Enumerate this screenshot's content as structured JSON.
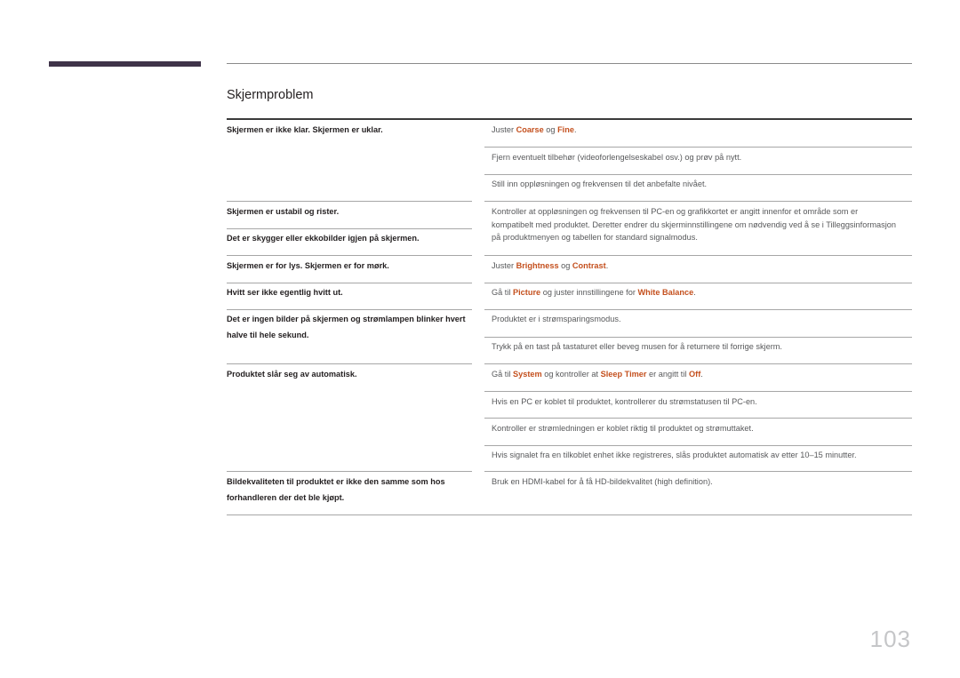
{
  "section": {
    "title": "Skjermproblem"
  },
  "page_number": "103",
  "colors": {
    "accent": "#c4501e",
    "top_bar": "#3f3349"
  },
  "rows": [
    {
      "problem": "Skjermen er ikke klar. Skjermen er uklar.",
      "solutions": [
        [
          {
            "t": "Juster "
          },
          {
            "t": "Coarse",
            "hl": true
          },
          {
            "t": " og "
          },
          {
            "t": "Fine",
            "hl": true
          },
          {
            "t": "."
          }
        ],
        [
          {
            "t": "Fjern eventuelt tilbehør (videoforlengelseskabel osv.) og prøv på nytt."
          }
        ],
        [
          {
            "t": "Still inn oppløsningen og frekvensen til det anbefalte nivået."
          }
        ]
      ]
    },
    {
      "problem": "Skjermen er ustabil og rister.",
      "solutions": [
        [
          {
            "t": "Kontroller at oppløsningen og frekvensen til PC-en og grafikkortet er angitt innenfor et område som er kompatibelt med produktet. Deretter endrer du skjerminnstillingene om nødvendig ved å se i Tilleggsinformasjon på produktmenyen og tabellen for standard signalmodus."
          }
        ]
      ]
    },
    {
      "problem": "Det er skygger eller ekkobilder igjen på skjermen.",
      "solutions": []
    },
    {
      "problem": "Skjermen er for lys. Skjermen er for mørk.",
      "solutions": [
        [
          {
            "t": "Juster "
          },
          {
            "t": "Brightness",
            "hl": true
          },
          {
            "t": " og "
          },
          {
            "t": "Contrast",
            "hl": true
          },
          {
            "t": "."
          }
        ]
      ]
    },
    {
      "problem": "Hvitt ser ikke egentlig hvitt ut.",
      "solutions": [
        [
          {
            "t": "Gå til "
          },
          {
            "t": "Picture",
            "hl": true
          },
          {
            "t": " og juster innstillingene for "
          },
          {
            "t": "White Balance",
            "hl": true
          },
          {
            "t": "."
          }
        ]
      ]
    },
    {
      "problem": "Det er ingen bilder på skjermen og strømlampen blinker hvert halve til hele sekund.",
      "solutions": [
        [
          {
            "t": "Produktet er i strømsparingsmodus."
          }
        ],
        [
          {
            "t": "Trykk på en tast på tastaturet eller beveg musen for å returnere til forrige skjerm."
          }
        ]
      ]
    },
    {
      "problem": "Produktet slår seg av automatisk.",
      "solutions": [
        [
          {
            "t": "Gå til "
          },
          {
            "t": "System",
            "hl": true
          },
          {
            "t": " og kontroller at "
          },
          {
            "t": "Sleep Timer",
            "hl": true
          },
          {
            "t": " er angitt til "
          },
          {
            "t": "Off",
            "hl": true
          },
          {
            "t": "."
          }
        ],
        [
          {
            "t": "Hvis en PC er koblet til produktet, kontrollerer du strømstatusen til PC-en."
          }
        ],
        [
          {
            "t": "Kontroller er strømledningen er koblet riktig til produktet og strømuttaket."
          }
        ],
        [
          {
            "t": "Hvis signalet fra en tilkoblet enhet ikke registreres, slås produktet automatisk av etter 10–15 minutter."
          }
        ]
      ]
    },
    {
      "problem": "Bildekvaliteten til produktet er ikke den samme som hos forhandleren der det ble kjøpt.",
      "solutions": [
        [
          {
            "t": "Bruk en HDMI-kabel for å få HD-bildekvalitet (high definition)."
          }
        ]
      ]
    }
  ]
}
